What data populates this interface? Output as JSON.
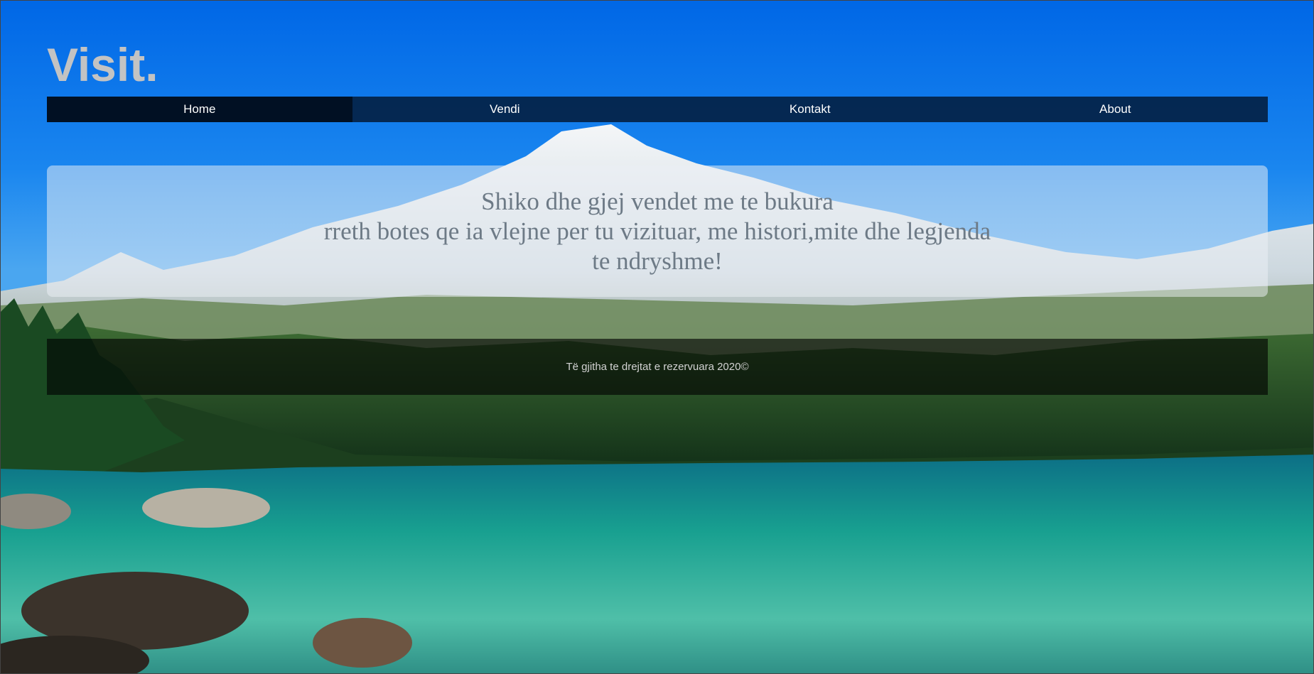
{
  "site": {
    "logo": "Visit."
  },
  "nav": {
    "items": [
      {
        "label": "Home",
        "active": true
      },
      {
        "label": "Vendi",
        "active": false
      },
      {
        "label": "Kontakt",
        "active": false
      },
      {
        "label": "About",
        "active": false
      }
    ]
  },
  "hero": {
    "line1": "Shiko dhe gjej vendet me te bukura",
    "line2": "rreth botes qe ia vlejne per tu vizituar, me histori,mite dhe legjenda",
    "line3": "te ndryshme!"
  },
  "footer": {
    "text": "Të gjitha te drejtat e rezervuara 2020©"
  },
  "colors": {
    "sky": "#0a6fe0",
    "nav_bg": "#021630",
    "logo": "#c3c3c3"
  }
}
